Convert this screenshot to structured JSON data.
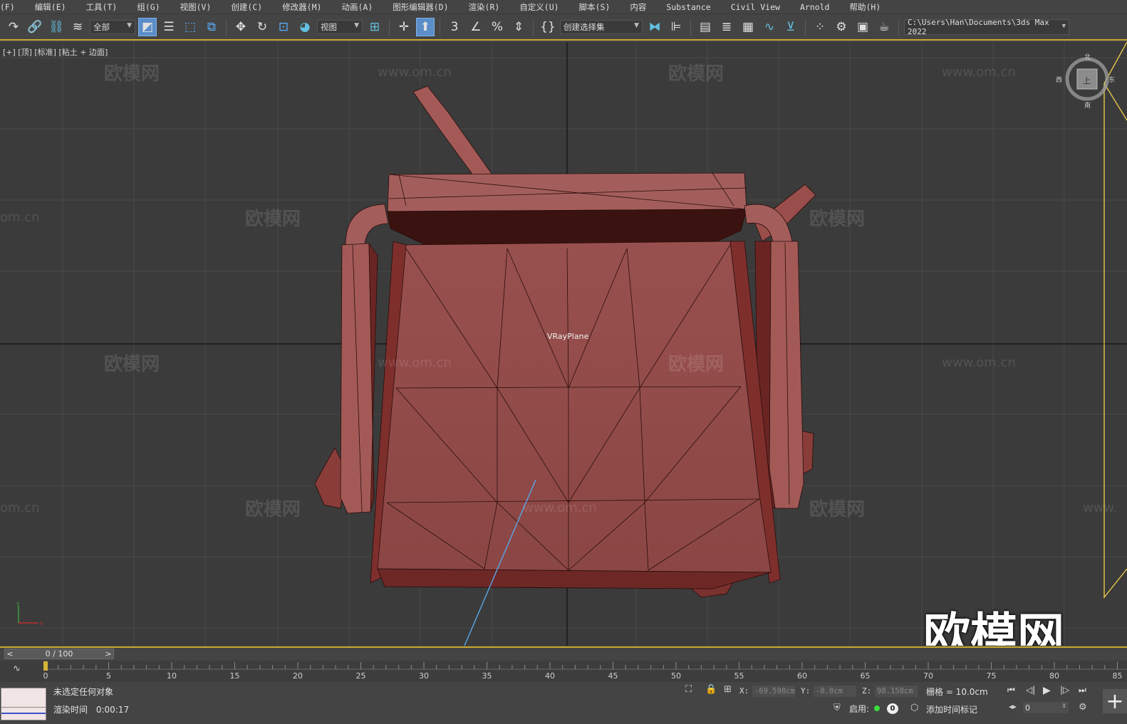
{
  "menu": {
    "items": [
      "(F)",
      "编辑(E)",
      "工具(T)",
      "组(G)",
      "视图(V)",
      "创建(C)",
      "修改器(M)",
      "动画(A)",
      "图形编辑器(D)",
      "渲染(R)",
      "自定义(U)",
      "脚本(S)",
      "内容",
      "Substance",
      "Civil View",
      "Arnold",
      "帮助(H)"
    ]
  },
  "toolbar": {
    "filter_dropdown": "全部",
    "refcoord_dropdown": "视图",
    "selection_set_dropdown": "创建选择集",
    "project_path": "C:\\Users\\Han\\Documents\\3ds Max 2022"
  },
  "viewport": {
    "label": "[+] [顶] [标准] [粘土 + 边面]",
    "object_label": "VRayPlane",
    "watermark_text": "欧模网",
    "watermark_url": "www.om.cn",
    "watermark_url_partial": "om.cn",
    "watermark_url_cut": "www.",
    "big_watermark": "欧模网",
    "viewcube": {
      "top": "上",
      "north": "北",
      "south": "南",
      "west": "西",
      "east": "东"
    },
    "model_color": "#8f4a48",
    "axis_y_label": "y",
    "axis_x_label": "x"
  },
  "timeslider": {
    "frame_display": "0 / 100",
    "prev_arrow": "<",
    "next_arrow": ">"
  },
  "trackbar": {
    "ticks": [
      "0",
      "5",
      "10",
      "15",
      "20",
      "25",
      "30",
      "35",
      "40",
      "45",
      "50",
      "55",
      "60",
      "65",
      "70",
      "75",
      "80",
      "85"
    ]
  },
  "status": {
    "message": "未选定任何对象",
    "render_time_label": "渲染时间",
    "render_time_value": "0:00:17",
    "x_label": "X:",
    "x_value": "-69.598cm",
    "y_label": "Y:",
    "y_value": "-0.0cm",
    "z_label": "Z:",
    "z_value": "98.158cm",
    "grid": "栅格 = 10.0cm",
    "enable_label": "启用:",
    "enable_count": "0",
    "add_time_tag": "添加时间标记",
    "current_frame": "0"
  },
  "colors": {
    "accent_yellow": "#c8a830",
    "active_blue": "#5b8ec9"
  }
}
